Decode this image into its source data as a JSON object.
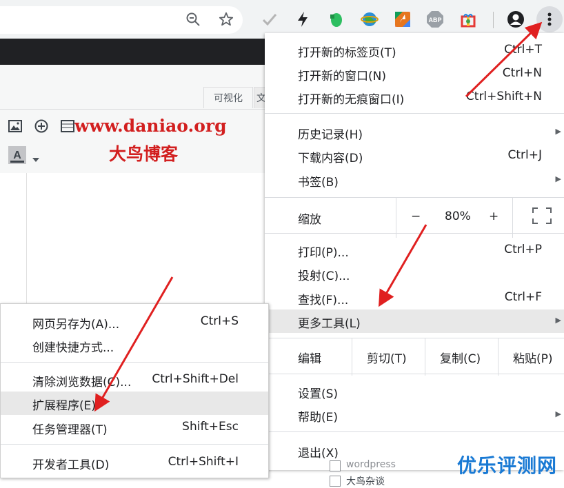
{
  "toolbar": {
    "icons": [
      "zoom-out-icon",
      "star-icon",
      "check-extension-icon",
      "bolt-extension-icon",
      "evernote-extension-icon",
      "globe-extension-icon",
      "drive-extension-icon",
      "abp-extension-icon",
      "gift-extension-icon",
      "profile-icon",
      "kebab-menu-icon"
    ],
    "abp_label": "ABP"
  },
  "editor": {
    "tab_visual": "可视化",
    "tab_text": "文",
    "watermark_url": "www.daniao.org",
    "watermark_name": "大鸟博客",
    "bottom_items": [
      "wordpress",
      "大鸟杂谈"
    ]
  },
  "menu": {
    "new_tab": {
      "label": "打开新的标签页(T)",
      "shortcut": "Ctrl+T"
    },
    "new_window": {
      "label": "打开新的窗口(N)",
      "shortcut": "Ctrl+N"
    },
    "new_incognito": {
      "label": "打开新的无痕窗口(I)",
      "shortcut": "Ctrl+Shift+N"
    },
    "history": {
      "label": "历史记录(H)"
    },
    "downloads": {
      "label": "下载内容(D)",
      "shortcut": "Ctrl+J"
    },
    "bookmarks": {
      "label": "书签(B)"
    },
    "zoom": {
      "label": "缩放",
      "minus": "−",
      "value": "80%",
      "plus": "+"
    },
    "print": {
      "label": "打印(P)...",
      "shortcut": "Ctrl+P"
    },
    "cast": {
      "label": "投射(C)..."
    },
    "find": {
      "label": "查找(F)...",
      "shortcut": "Ctrl+F"
    },
    "more_tools": {
      "label": "更多工具(L)"
    },
    "edit": {
      "label": "编辑",
      "cut": "剪切(T)",
      "copy": "复制(C)",
      "paste": "粘贴(P)"
    },
    "settings": {
      "label": "设置(S)"
    },
    "help": {
      "label": "帮助(E)"
    },
    "exit": {
      "label": "退出(X)"
    }
  },
  "submenu": {
    "save_as": {
      "label": "网页另存为(A)...",
      "shortcut": "Ctrl+S"
    },
    "create_shortcut": {
      "label": "创建快捷方式..."
    },
    "clear_data": {
      "label": "清除浏览数据(C)...",
      "shortcut": "Ctrl+Shift+Del"
    },
    "extensions": {
      "label": "扩展程序(E)"
    },
    "task_manager": {
      "label": "任务管理器(T)",
      "shortcut": "Shift+Esc"
    },
    "dev_tools": {
      "label": "开发者工具(D)",
      "shortcut": "Ctrl+Shift+I"
    }
  },
  "brand_watermark": "优乐评测网",
  "colors": {
    "annotation_arrow": "#e02020",
    "watermark_red": "#d21f1f",
    "brand_blue": "#1a7ad4"
  }
}
